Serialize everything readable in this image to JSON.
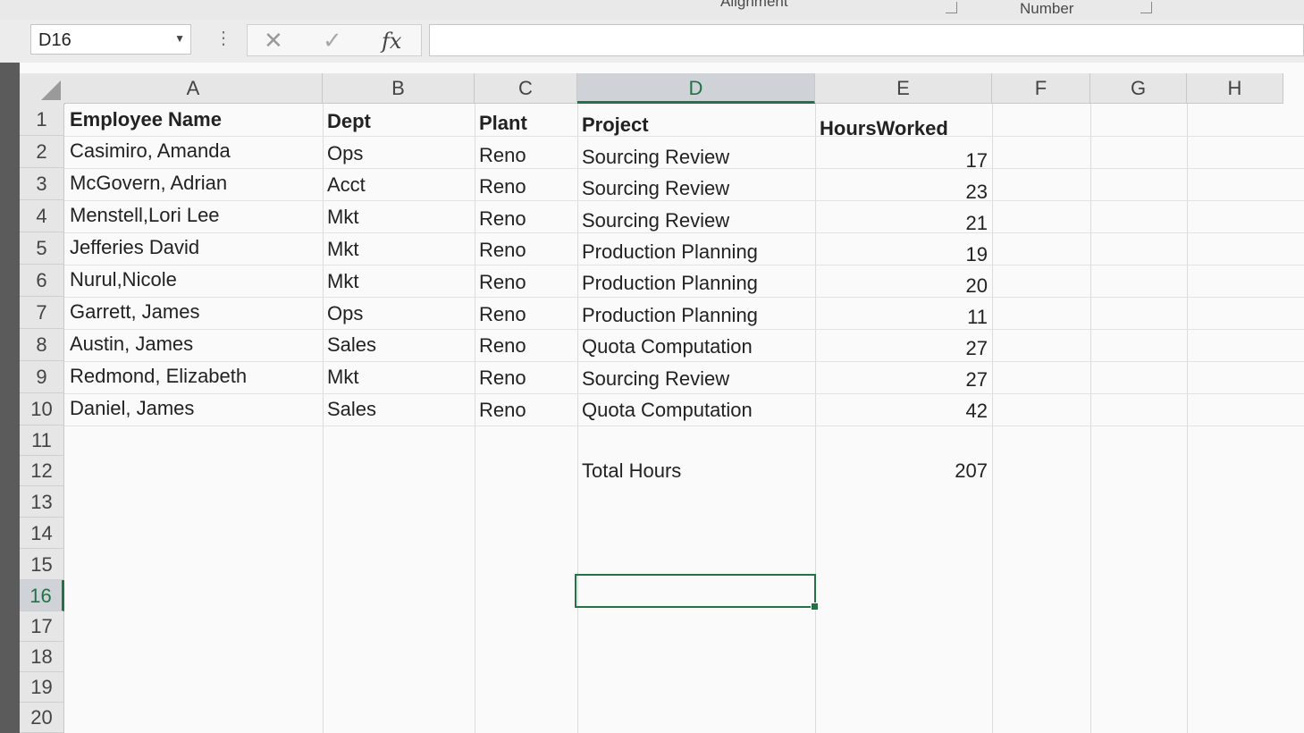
{
  "ribbon": {
    "group_alignment": "Alignment",
    "group_number": "Number"
  },
  "formula_bar": {
    "name_box": "D16",
    "cancel_icon": "x-icon",
    "enter_icon": "check-icon",
    "function_label": "fx",
    "formula_value": ""
  },
  "sheet": {
    "columns": [
      "A",
      "B",
      "C",
      "D",
      "E",
      "F",
      "G",
      "H"
    ],
    "selected_column": "D",
    "rows": [
      "1",
      "2",
      "3",
      "4",
      "5",
      "6",
      "7",
      "8",
      "9",
      "10",
      "11",
      "12",
      "13",
      "14",
      "15",
      "16",
      "17",
      "18",
      "19",
      "20"
    ],
    "selected_row": "16",
    "headers": {
      "a": "Employee Name",
      "b": "Dept",
      "c": "Plant",
      "d": "Project",
      "e": "HoursWorked"
    },
    "data": [
      {
        "name": "Casimiro, Amanda",
        "dept": "Ops",
        "plant": "Reno",
        "project": "Sourcing Review",
        "hours": "17"
      },
      {
        "name": "McGovern, Adrian",
        "dept": "Acct",
        "plant": "Reno",
        "project": "Sourcing Review",
        "hours": "23"
      },
      {
        "name": "Menstell,Lori  Lee",
        "dept": "Mkt",
        "plant": "Reno",
        "project": "Sourcing Review",
        "hours": "21"
      },
      {
        "name": "Jefferies David",
        "dept": "Mkt",
        "plant": "Reno",
        "project": "Production Planning",
        "hours": "19"
      },
      {
        "name": "Nurul,Nicole",
        "dept": "Mkt",
        "plant": "Reno",
        "project": "Production Planning",
        "hours": "20"
      },
      {
        "name": "Garrett, James",
        "dept": "Ops",
        "plant": "Reno",
        "project": "Production Planning",
        "hours": "11"
      },
      {
        "name": "Austin, James",
        "dept": "Sales",
        "plant": "Reno",
        "project": "Quota Computation",
        "hours": "27"
      },
      {
        "name": "Redmond, Elizabeth",
        "dept": "Mkt",
        "plant": "Reno",
        "project": "Sourcing Review",
        "hours": "27"
      },
      {
        "name": "Daniel, James",
        "dept": "Sales",
        "plant": "Reno",
        "project": "Quota Computation",
        "hours": "42"
      }
    ],
    "total_label": "Total Hours",
    "total_value": "207"
  },
  "colors": {
    "accent": "#217346"
  }
}
